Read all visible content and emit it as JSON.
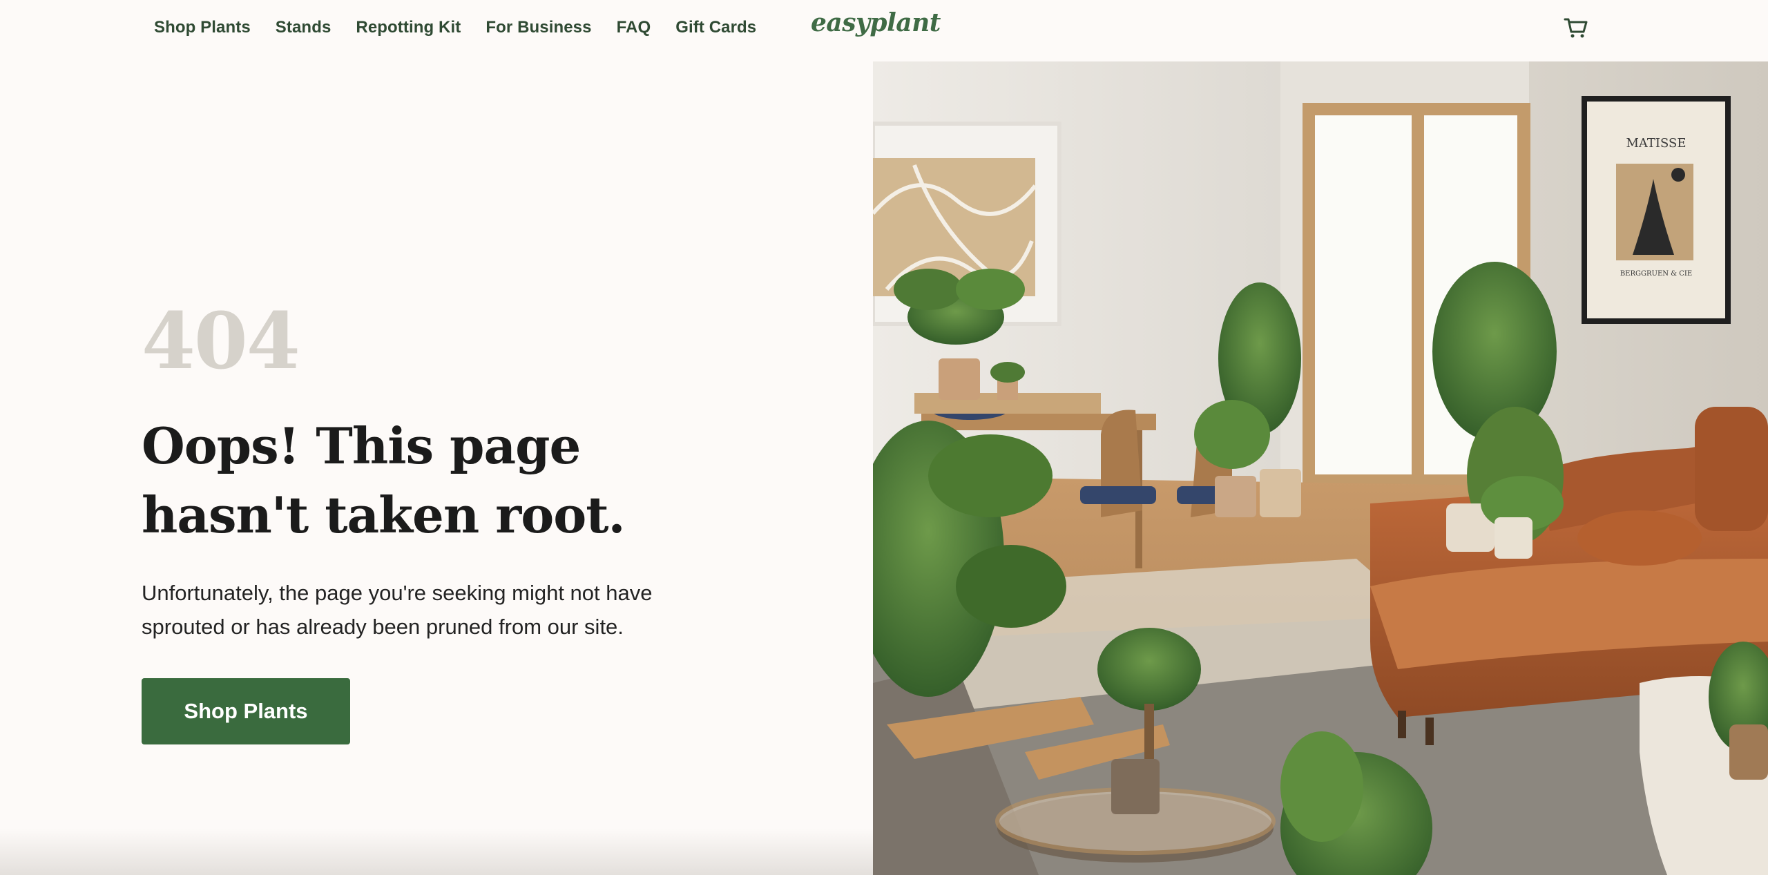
{
  "nav": {
    "items": [
      "Shop Plants",
      "Stands",
      "Repotting Kit",
      "For Business",
      "FAQ",
      "Gift Cards"
    ]
  },
  "brand": {
    "name": "easyplant",
    "color": "#3f6b45"
  },
  "error": {
    "code": "404",
    "headline": "Oops! This page hasn't taken root.",
    "description": "Unfortunately, the page you're seeking might not have sprouted or has already been pruned from our site.",
    "cta_label": "Shop Plants"
  },
  "hero_image": {
    "poster_title": "MATISSE",
    "poster_subtitle": "BERGGRUEN & CIE"
  },
  "colors": {
    "accent": "#3a6b3e",
    "nav_text": "#2f4a33",
    "code_muted": "#d6d2cb",
    "background": "#fdfaf8"
  },
  "icons": [
    "cart-icon"
  ]
}
